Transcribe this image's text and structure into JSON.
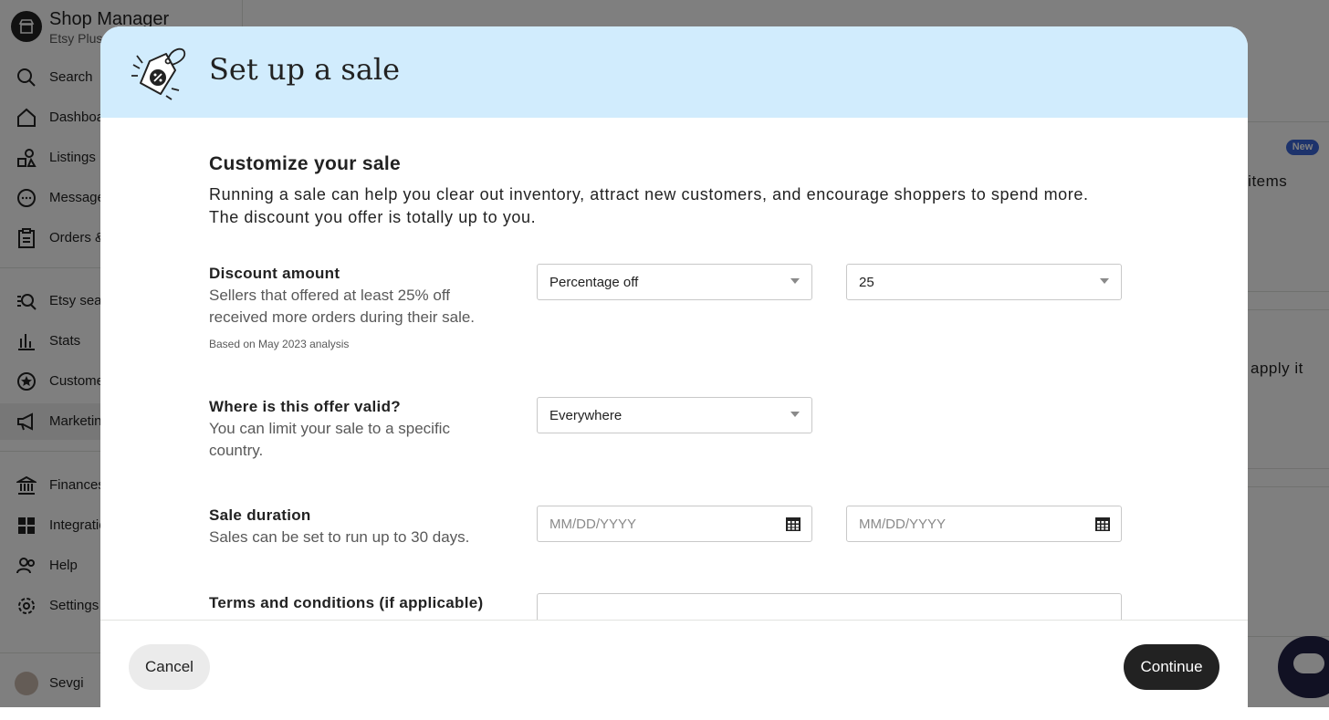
{
  "app": {
    "title": "Shop Manager",
    "subtitle": "Etsy Plus"
  },
  "sidebar": {
    "items": [
      {
        "label": "Search",
        "icon": "search-icon"
      },
      {
        "label": "Dashboard",
        "icon": "home-icon"
      },
      {
        "label": "Listings",
        "icon": "listings-icon"
      },
      {
        "label": "Messages",
        "icon": "messages-icon"
      },
      {
        "label": "Orders & Shipping",
        "icon": "clipboard-icon"
      },
      {
        "label": "Etsy search",
        "icon": "search-analytics-icon"
      },
      {
        "label": "Stats",
        "icon": "stats-icon"
      },
      {
        "label": "Customer service",
        "icon": "star-badge-icon"
      },
      {
        "label": "Marketing",
        "icon": "megaphone-icon"
      },
      {
        "label": "Finances",
        "icon": "bank-icon"
      },
      {
        "label": "Integrations",
        "icon": "grid-icon"
      },
      {
        "label": "Help",
        "icon": "people-icon"
      },
      {
        "label": "Settings",
        "icon": "gear-icon"
      }
    ],
    "user": {
      "name": "Sevgi"
    }
  },
  "background": {
    "badge": "New",
    "text_1": "n items",
    "text_2": "apply it"
  },
  "modal": {
    "title": "Set up a sale",
    "section_title": "Customize your sale",
    "section_desc": "Running a sale can help you clear out inventory, attract new customers, and encourage shoppers to spend more. The discount you offer is totally up to you.",
    "discount": {
      "label": "Discount amount",
      "desc": "Sellers that offered at least 25% off received more orders during their sale.",
      "note": "Based on May 2023 analysis",
      "type_value": "Percentage off",
      "amount_value": "25"
    },
    "location": {
      "label": "Where is this offer valid?",
      "desc": "You can limit your sale to a specific country.",
      "value": "Everywhere"
    },
    "duration": {
      "label": "Sale duration",
      "desc": "Sales can be set to run up to 30 days.",
      "start_placeholder": "MM/DD/YYYY",
      "end_placeholder": "MM/DD/YYYY"
    },
    "terms": {
      "label": "Terms and conditions (if applicable)",
      "value": ""
    },
    "buttons": {
      "cancel": "Cancel",
      "continue": "Continue"
    }
  },
  "colors": {
    "header_bg": "#d1ecfd",
    "primary_button": "#222222",
    "badge": "#3b67d9",
    "overlay": "rgba(0,0,0,0.5)"
  }
}
